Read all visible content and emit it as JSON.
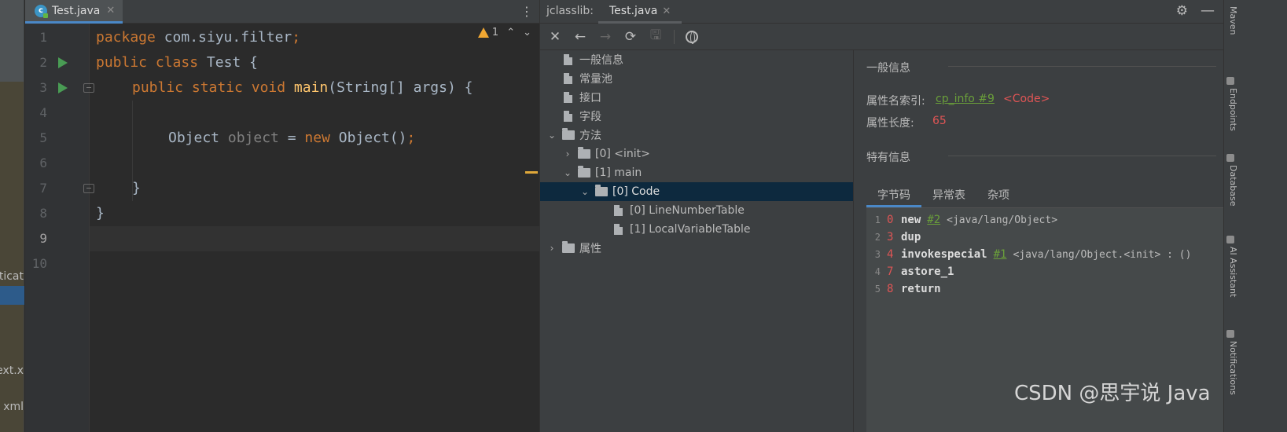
{
  "sidebar_left": {
    "frag1": "ticat",
    "frag2": "ext.x",
    "frag3": "xml"
  },
  "editor": {
    "tab": {
      "label": "Test.java",
      "close": "✕",
      "icon_glyph": "c"
    },
    "kebab": "⋮",
    "inspection": {
      "warning_count": "1",
      "up": "⌃",
      "down": "⌄"
    },
    "line_numbers": [
      "1",
      "2",
      "3",
      "4",
      "5",
      "6",
      "7",
      "8",
      "9",
      "10"
    ],
    "code": {
      "l1_kw": "package",
      "l1_rest": " com.siyu.filter",
      "l1_semi": ";",
      "l2_kw1": "public",
      "l2_kw2": " class",
      "l2_rest": " Test {",
      "l3_kw1": "public",
      "l3_kw2": " static",
      "l3_kw3": " void",
      "l3_fn": " main",
      "l3_rest": "(String[] args) {",
      "l5_type": "Object",
      "l5_var": " object",
      "l5_eq": " = ",
      "l5_new": "new",
      "l5_rest": " Object()",
      "l5_semi": ";",
      "l7": "}",
      "l8": "}"
    }
  },
  "jclasslib": {
    "title": "jclasslib:",
    "tab_label": "Test.java",
    "tab_close": "✕",
    "toolbar": {
      "close": "✕",
      "back": "←",
      "forward": "→",
      "refresh": "⟳",
      "save": "🖫"
    },
    "tree": {
      "general": "一般信息",
      "constant_pool": "常量池",
      "interfaces": "接口",
      "fields": "字段",
      "methods": "方法",
      "method_init": "[0] <init>",
      "method_main": "[1] main",
      "code": "[0] Code",
      "line_number_table": "[0] LineNumberTable",
      "local_variable_table": "[1] LocalVariableTable",
      "attributes": "属性"
    },
    "details": {
      "general_header": "一般信息",
      "attr_name_index_label": "属性名索引:",
      "attr_name_index_link": "cp_info #9",
      "attr_name_value": "<Code>",
      "attr_length_label": "属性长度:",
      "attr_length_value": "65",
      "specific_header": "特有信息",
      "subtabs": [
        "字节码",
        "异常表",
        "杂项"
      ],
      "bytecode": [
        {
          "ln": "1",
          "off": "0",
          "op": "new",
          "ref": "#2",
          "arg": "<java/lang/Object>"
        },
        {
          "ln": "2",
          "off": "3",
          "op": "dup",
          "ref": "",
          "arg": ""
        },
        {
          "ln": "3",
          "off": "4",
          "op": "invokespecial",
          "ref": "#1",
          "arg": "<java/lang/Object.<init> : ()"
        },
        {
          "ln": "4",
          "off": "7",
          "op": "astore_1",
          "ref": "",
          "arg": ""
        },
        {
          "ln": "5",
          "off": "8",
          "op": "return",
          "ref": "",
          "arg": ""
        }
      ]
    },
    "gear": "⚙",
    "minimize": "—"
  },
  "right_strip": {
    "maven": "Maven",
    "endpoints": "Endpoints",
    "database": "Database",
    "ai": "AI Assistant",
    "notifications": "Notifications"
  },
  "watermark": "CSDN @思宇说 Java",
  "colors": {
    "keyword": "#cc7832",
    "function": "#ffc66d",
    "selection": "#0d293e",
    "accent": "#4a88c7",
    "error_red": "#e05555",
    "link_green": "#6a9f3a"
  }
}
